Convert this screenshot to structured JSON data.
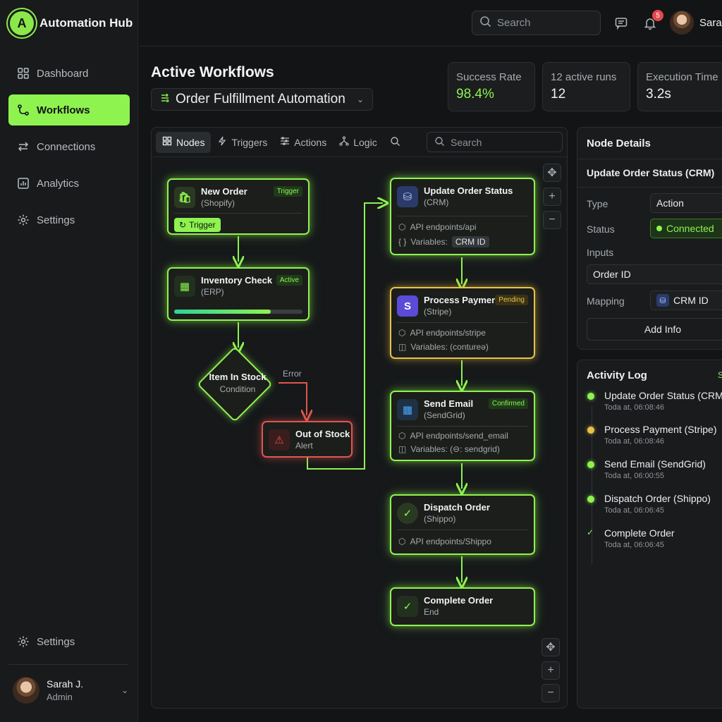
{
  "app": {
    "name": "Automation Hub"
  },
  "sidebar": {
    "items": [
      {
        "label": "Dashboard",
        "icon": "grid-icon"
      },
      {
        "label": "Workflows",
        "icon": "workflow-icon",
        "active": true
      },
      {
        "label": "Connections",
        "icon": "arrows-icon"
      },
      {
        "label": "Analytics",
        "icon": "chart-icon"
      },
      {
        "label": "Settings",
        "icon": "gear-icon"
      }
    ],
    "bottom_settings": "Settings",
    "user": {
      "name": "Sarah J.",
      "role": "Admin"
    }
  },
  "topbar": {
    "search_placeholder": "Search",
    "notification_count": "5",
    "user_name": "Sarah"
  },
  "main": {
    "title": "Active Workflows",
    "workflow_selected": "Order Fulfillment Automation"
  },
  "stats": [
    {
      "label": "Success Rate",
      "value": "98.4%",
      "accent": true
    },
    {
      "label": "12 active runs",
      "value": "12"
    },
    {
      "label": "Execution Time",
      "value": "3.2s"
    }
  ],
  "canvas": {
    "tools": [
      "Nodes",
      "Triggers",
      "Actions",
      "Logic"
    ],
    "search_placeholder": "Search",
    "error_label": "Error",
    "nodes": {
      "new_order": {
        "title": "New Order",
        "sub": "(Shopify)",
        "tag": "Trigger",
        "button": "Trigger"
      },
      "inventory": {
        "title": "Inventory Check",
        "sub": "(ERP)",
        "tag": "Active",
        "progress": 0.75
      },
      "condition": {
        "title": "Item In Stock",
        "sub": "Condition"
      },
      "out_of_stock": {
        "title": "Out of Stock",
        "sub": "Alert"
      },
      "update_order": {
        "title": "Update Order Status",
        "sub": "(CRM)",
        "line1": "API endpoints/api",
        "line2_label": "Variables:",
        "line2_chip": "CRM ID"
      },
      "payment": {
        "title": "Process Payment",
        "sub": "(Stripe)",
        "tag": "Pending",
        "line1": "API endpoints/stripe",
        "line2": "Variables: (contureə)"
      },
      "email": {
        "title": "Send Email",
        "sub": "(SendGrid)",
        "tag": "Confirmed",
        "line1": "API endpoints/send_email",
        "line2": "Variables: (⊖: sendgrid)"
      },
      "dispatch": {
        "title": "Dispatch Order",
        "sub": "(Shippo)",
        "line1": "API endpoints/Shippo"
      },
      "complete": {
        "title": "Complete Order",
        "sub": "End"
      }
    }
  },
  "details": {
    "title": "Node Details",
    "node_name": "Update Order Status (CRM)",
    "type_label": "Type",
    "type_value": "Action",
    "status_label": "Status",
    "status_value": "Connected",
    "inputs_label": "Inputs",
    "inputs_value": "Order ID",
    "mapping_label": "Mapping",
    "mapping_value": "CRM ID",
    "add_button": "Add Info"
  },
  "activity": {
    "title": "Activity Log",
    "corner": "S",
    "items": [
      {
        "title": "Update Order Status (CRM)",
        "time": "Toda at, 06:08:46",
        "status": "green"
      },
      {
        "title": "Process Payment (Stripe)",
        "time": "Toda at, 06:08:46",
        "status": "amber"
      },
      {
        "title": "Send Email (SendGrid)",
        "time": "Toda at, 06:00:55",
        "status": "green"
      },
      {
        "title": "Dispatch Order (Shippo)",
        "time": "Toda at, 06:06:45",
        "status": "green"
      },
      {
        "title": "Complete Order",
        "time": "Toda at, 06:06:45",
        "status": "check"
      }
    ]
  },
  "colors": {
    "accent": "#8ef34f",
    "amber": "#e8c24a",
    "error": "#e0564f",
    "background": "#131416"
  }
}
